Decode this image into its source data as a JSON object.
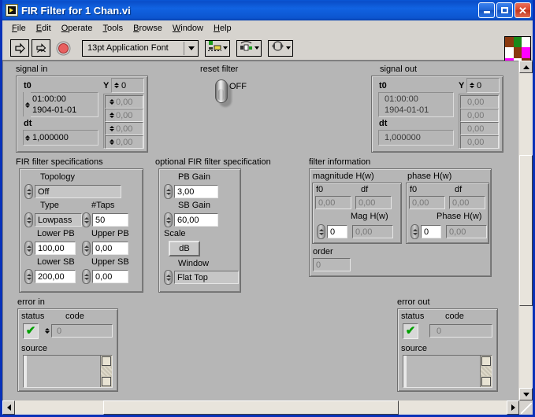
{
  "window": {
    "title": "FIR Filter for 1 Chan.vi",
    "icon": "labview-vi-icon",
    "minimize_label": "Minimize",
    "maximize_label": "Maximize",
    "close_label": "Close"
  },
  "menubar": {
    "items": [
      {
        "label": "File",
        "mnemonic": "F"
      },
      {
        "label": "Edit",
        "mnemonic": "E"
      },
      {
        "label": "Operate",
        "mnemonic": "O"
      },
      {
        "label": "Tools",
        "mnemonic": "T"
      },
      {
        "label": "Browse",
        "mnemonic": "B"
      },
      {
        "label": "Window",
        "mnemonic": "W"
      },
      {
        "label": "Help",
        "mnemonic": "H"
      }
    ]
  },
  "toolbar": {
    "run_label": "Run",
    "run_continuous_label": "Run Continuously",
    "abort_label": "Abort Execution",
    "font_selector": "13pt Application Font",
    "align_objects_label": "Align Objects",
    "distribute_objects_label": "Distribute Objects",
    "reorder_label": "Reorder"
  },
  "panel": {
    "signal_in": {
      "title": "signal in",
      "t0_label": "t0",
      "t0_time": "01:00:00",
      "t0_date": "1904-01-01",
      "dt_label": "dt",
      "dt_value": "1,000000",
      "y_label": "Y",
      "y_index": "0",
      "y_values": [
        "0,00",
        "0,00",
        "0,00",
        "0,00"
      ]
    },
    "reset_filter": {
      "title": "reset filter",
      "state": "OFF"
    },
    "signal_out": {
      "title": "signal out",
      "t0_label": "t0",
      "t0_time": "01:00:00",
      "t0_date": "1904-01-01",
      "dt_label": "dt",
      "dt_value": "1,000000",
      "y_label": "Y",
      "y_index": "0",
      "y_values": [
        "0,00",
        "0,00",
        "0,00",
        "0,00"
      ]
    },
    "fir_specs": {
      "title": "FIR filter specifications",
      "topology_label": "Topology",
      "topology_value": "Off",
      "type_label": "Type",
      "type_value": "Lowpass",
      "taps_label": "#Taps",
      "taps_value": "50",
      "lower_pb_label": "Lower PB",
      "lower_pb_value": "100,00",
      "upper_pb_label": "Upper PB",
      "upper_pb_value": "0,00",
      "lower_sb_label": "Lower SB",
      "lower_sb_value": "200,00",
      "upper_sb_label": "Upper SB",
      "upper_sb_value": "0,00"
    },
    "optional_specs": {
      "title": "optional FIR filter specification",
      "pb_gain_label": "PB Gain",
      "pb_gain_value": "3,00",
      "sb_gain_label": "SB Gain",
      "sb_gain_value": "60,00",
      "scale_label": "Scale",
      "scale_value": "dB",
      "window_label": "Window",
      "window_value": "Flat Top"
    },
    "filter_info": {
      "title": "filter information",
      "magnitude": {
        "title": "magnitude H(w)",
        "f0_label": "f0",
        "f0_value": "0,00",
        "df_label": "df",
        "df_value": "0,00",
        "array_label": "Mag H(w)",
        "index": "0",
        "value": "0,00"
      },
      "phase": {
        "title": "phase H(w)",
        "f0_label": "f0",
        "f0_value": "0,00",
        "df_label": "df",
        "df_value": "0,00",
        "array_label": "Phase H(w)",
        "index": "0",
        "value": "0,00"
      },
      "order_label": "order",
      "order_value": "0"
    },
    "error_in": {
      "title": "error in",
      "status_label": "status",
      "status_value": "no-error",
      "code_label": "code",
      "code_value": "0",
      "source_label": "source",
      "source_value": ""
    },
    "error_out": {
      "title": "error out",
      "status_label": "status",
      "status_value": "no-error",
      "code_label": "code",
      "code_value": "0",
      "source_label": "source",
      "source_value": ""
    }
  },
  "colors": {
    "titlebar": "#0a56d6",
    "panel_bg": "#b6b6b6",
    "chrome_bg": "#d6d3ce",
    "ok_green": "#00a000",
    "abort_red": "#e05050"
  }
}
